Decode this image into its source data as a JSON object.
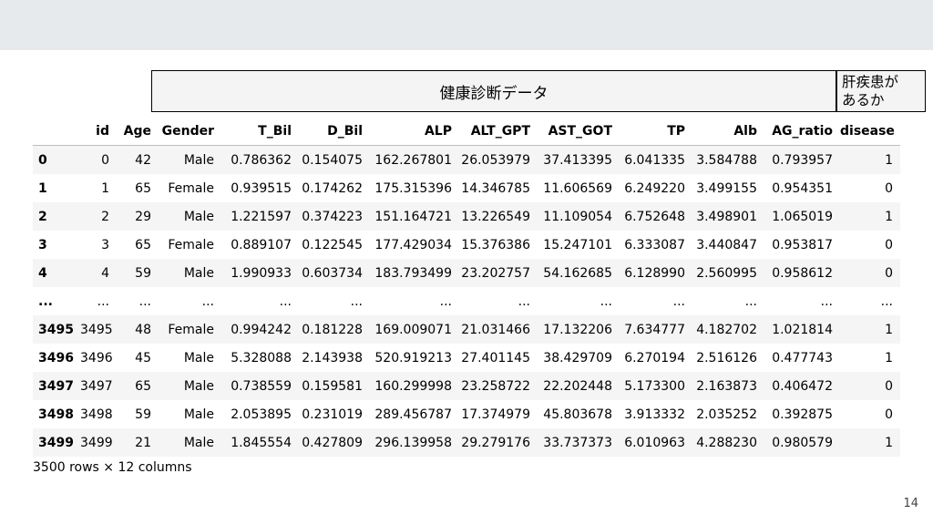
{
  "header": {
    "title": "健康診断データ",
    "target_label_line1": "肝疾患が",
    "target_label_line2": "あるか"
  },
  "table": {
    "columns": [
      "",
      "id",
      "Age",
      "Gender",
      "T_Bil",
      "D_Bil",
      "ALP",
      "ALT_GPT",
      "AST_GOT",
      "TP",
      "Alb",
      "AG_ratio",
      "disease"
    ],
    "rows": [
      [
        "0",
        "0",
        "42",
        "Male",
        "0.786362",
        "0.154075",
        "162.267801",
        "26.053979",
        "37.413395",
        "6.041335",
        "3.584788",
        "0.793957",
        "1"
      ],
      [
        "1",
        "1",
        "65",
        "Female",
        "0.939515",
        "0.174262",
        "175.315396",
        "14.346785",
        "11.606569",
        "6.249220",
        "3.499155",
        "0.954351",
        "0"
      ],
      [
        "2",
        "2",
        "29",
        "Male",
        "1.221597",
        "0.374223",
        "151.164721",
        "13.226549",
        "11.109054",
        "6.752648",
        "3.498901",
        "1.065019",
        "1"
      ],
      [
        "3",
        "3",
        "65",
        "Female",
        "0.889107",
        "0.122545",
        "177.429034",
        "15.376386",
        "15.247101",
        "6.333087",
        "3.440847",
        "0.953817",
        "0"
      ],
      [
        "4",
        "4",
        "59",
        "Male",
        "1.990933",
        "0.603734",
        "183.793499",
        "23.202757",
        "54.162685",
        "6.128990",
        "2.560995",
        "0.958612",
        "0"
      ],
      [
        "...",
        "...",
        "...",
        "...",
        "...",
        "...",
        "...",
        "...",
        "...",
        "...",
        "...",
        "...",
        "..."
      ],
      [
        "3495",
        "3495",
        "48",
        "Female",
        "0.994242",
        "0.181228",
        "169.009071",
        "21.031466",
        "17.132206",
        "7.634777",
        "4.182702",
        "1.021814",
        "1"
      ],
      [
        "3496",
        "3496",
        "45",
        "Male",
        "5.328088",
        "2.143938",
        "520.919213",
        "27.401145",
        "38.429709",
        "6.270194",
        "2.516126",
        "0.477743",
        "1"
      ],
      [
        "3497",
        "3497",
        "65",
        "Male",
        "0.738559",
        "0.159581",
        "160.299998",
        "23.258722",
        "22.202448",
        "5.173300",
        "2.163873",
        "0.406472",
        "0"
      ],
      [
        "3498",
        "3498",
        "59",
        "Male",
        "2.053895",
        "0.231019",
        "289.456787",
        "17.374979",
        "45.803678",
        "3.913332",
        "2.035252",
        "0.392875",
        "0"
      ],
      [
        "3499",
        "3499",
        "21",
        "Male",
        "1.845554",
        "0.427809",
        "296.139958",
        "29.279176",
        "33.737373",
        "6.010963",
        "4.288230",
        "0.980579",
        "1"
      ]
    ]
  },
  "shape_text": "3500 rows × 12 columns",
  "page_number": "14",
  "colors": {
    "top_band": "#e7eaed",
    "header_box": "#f4f4f4",
    "row_stripe": "#f5f5f5"
  }
}
